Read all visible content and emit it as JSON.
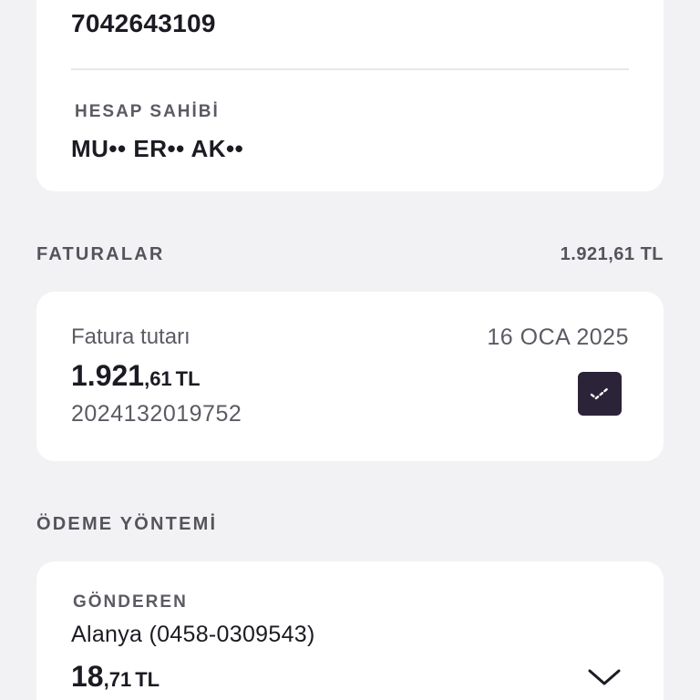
{
  "account": {
    "number": "7042643109",
    "owner_label": "HESAP SAHİBİ",
    "owner_name": "MU•• ER•• AK••"
  },
  "bills_section": {
    "title": "FATURALAR",
    "total": "1.921,61 TL"
  },
  "bill": {
    "label": "Fatura tutarı",
    "date": "16 OCA 2025",
    "amount_main": "1.921",
    "amount_decimal": ",61",
    "currency": "TL",
    "reference": "2024132019752",
    "selected": true,
    "check_icon": "check-icon"
  },
  "payment_section": {
    "title": "ÖDEME YÖNTEMİ"
  },
  "payment": {
    "sender_label": "GÖNDEREN",
    "sender_branch": "Alanya (0458-0309543)",
    "balance_main": "18",
    "balance_decimal": ",71",
    "currency": "TL",
    "dropdown_icon": "chevron-down-icon"
  },
  "colors": {
    "background": "#f2f2f4",
    "card": "#ffffff",
    "accent_dark": "#2b2338",
    "text_primary": "#1c1a22",
    "text_secondary": "#5c5a63"
  }
}
